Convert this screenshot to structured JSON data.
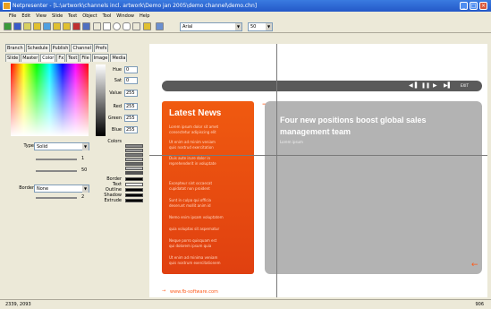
{
  "window": {
    "title": "Netpresenter - [L:\\artwork\\channels incl. artwork\\Demo jan 2005\\demo channel\\demo.chn]",
    "minimize": "_",
    "maximize": "□",
    "close": "×"
  },
  "menu": [
    "File",
    "Edit",
    "View",
    "Slide",
    "Text",
    "Object",
    "Tool",
    "Window",
    "Help"
  ],
  "toolbar": {
    "font_value": "Arial",
    "size_value": "50",
    "icons": [
      "play-icon",
      "stop-icon",
      "image-icon",
      "pointer-icon",
      "rect-icon",
      "ellipse-icon",
      "text-icon",
      "help-icon"
    ]
  },
  "tabs_top": [
    "Branch",
    "Schedule",
    "Publish",
    "Channel",
    "Prefs"
  ],
  "tabs_bottom": [
    "Slide",
    "Master",
    "Color",
    "Fx",
    "Text",
    "File",
    "Image",
    "Media"
  ],
  "color_panel": {
    "hue_label": "Hue",
    "hue_value": "0",
    "sat_label": "Sat",
    "sat_value": "0",
    "value_label": "Value",
    "value_value": "255",
    "red_label": "Red",
    "red_value": "255",
    "green_label": "Green",
    "green_value": "255",
    "blue_label": "Blue",
    "blue_value": "255",
    "colors_label": "Colors",
    "type_label": "Type",
    "type_value": "Solid",
    "border_label": "Border",
    "border_value": "None",
    "slider_value_1": "1",
    "slider_value_2": "50",
    "slider_value_3": "2",
    "targets": [
      "Border",
      "Text",
      "Outline",
      "Shadow",
      "Extrude"
    ]
  },
  "slide": {
    "news_title": "Latest News",
    "news_items": [
      "Lorem ipsum dolor sit amet",
      "consectetur adipiscing elit",
      "Ut enim ad minim veniam",
      "quis nostrud exercitation",
      "Duis aute irure dolor in",
      "reprehenderit in voluptate",
      "Excepteur sint occaecat",
      "cupidatat non proident",
      "Sunt in culpa qui officia",
      "deserunt mollit anim id",
      "Nemo enim ipsam voluptatem",
      "quia voluptas sit aspernatur",
      "Neque porro quisquam est",
      "qui dolorem ipsum quia",
      "Ut enim ad minima veniam",
      "quis nostrum exercitationem"
    ],
    "headline": "Four new positions boost global sales management team",
    "headline_sub": "Lorem ipsum",
    "player_label": "EXIT",
    "footer_url": "www.fb-software.com"
  },
  "status": {
    "left": "2339, 2093",
    "right": "906"
  },
  "colors": {
    "news_orange": "#f05a10",
    "accent_orange": "#ff5a1a",
    "panel_gray": "#b3b3b3"
  }
}
